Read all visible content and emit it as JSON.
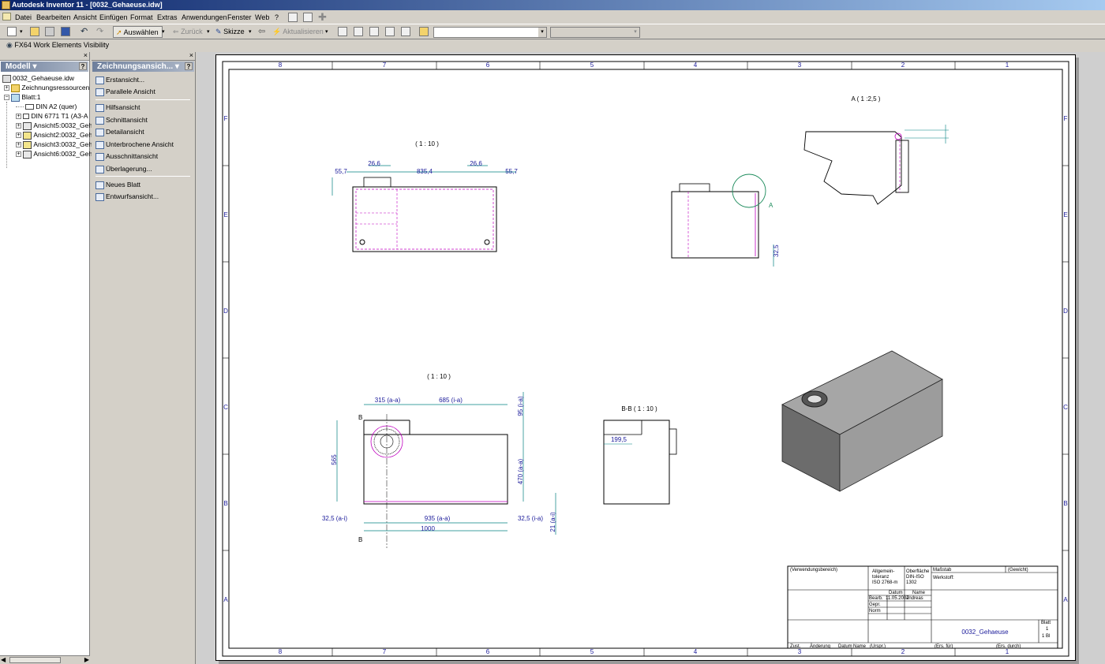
{
  "window": {
    "title": "Autodesk Inventor 11 - [0032_Gehaeuse.idw]"
  },
  "menu": [
    "Datei",
    "Bearbeiten",
    "Ansicht",
    "Einfügen",
    "Format",
    "Extras",
    "Anwendungen",
    "Fenster",
    "Web",
    "?"
  ],
  "toolbar": {
    "select_label": "Auswählen",
    "back_label": "Zurück",
    "sketch_label": "Skizze",
    "update_label": "Aktualisieren"
  },
  "toolbar2": {
    "visibility_label": "FX64 Work Elements Visibility"
  },
  "browser": {
    "title": "Modell",
    "root": "0032_Gehaeuse.idw",
    "items": [
      {
        "label": "Zeichnungsressourcen"
      },
      {
        "label": "Blatt:1"
      },
      {
        "label": "DIN A2 (quer)"
      },
      {
        "label": "DIN 6771 T1 (A3-A"
      },
      {
        "label": "Ansicht5:0032_Geh"
      },
      {
        "label": "Ansicht2:0032_Geh"
      },
      {
        "label": "Ansicht3:0032_Geh"
      },
      {
        "label": "Ansicht6:0032_Geh"
      }
    ]
  },
  "panel": {
    "title": "Zeichnungsansich...",
    "items": [
      {
        "label": "Erstansicht..."
      },
      {
        "label": "Parallele Ansicht"
      },
      {
        "label": "Hilfsansicht"
      },
      {
        "label": "Schnittansicht"
      },
      {
        "label": "Detailansicht"
      },
      {
        "label": "Unterbrochene Ansicht"
      },
      {
        "label": "Ausschnittansicht"
      },
      {
        "label": "Überlagerung..."
      },
      {
        "label": "Neues Blatt"
      },
      {
        "label": "Entwurfsansicht..."
      }
    ]
  },
  "drawing": {
    "zone_cols": [
      "8",
      "7",
      "6",
      "5",
      "4",
      "3",
      "2",
      "1"
    ],
    "zone_rows": [
      "F",
      "E",
      "D",
      "C",
      "B",
      "A"
    ],
    "view_top": {
      "scale": "( 1 : 10 )",
      "dims": [
        "55,7",
        "26,6",
        "835,4",
        "26,6",
        "55,7"
      ]
    },
    "view_side": {
      "detail_label": "A",
      "dim": "32,5"
    },
    "view_detail": {
      "label": "A ( 1 :2,5 )"
    },
    "view_front": {
      "scale": "( 1 : 10 )",
      "dims": [
        "315 (a-a)",
        "685 (i-a)",
        "95 (i-a)",
        "565",
        "470 (a-a)",
        "32,5 (a-i)",
        "935 (a-a)",
        "32,5 (i-a)",
        "21 (a-i)",
        "1000"
      ],
      "section_mark": "B"
    },
    "view_section": {
      "label": "B-B ( 1 : 10 )",
      "dim": "199,5"
    },
    "titleblock": {
      "usage": "(Verwendungsbereich)",
      "tolerance": "Allgemein-\ntoleranz\nISO 2768-m",
      "surface": "Oberfläche\nDIN-ISO\n1302",
      "scale": "Maßstab",
      "weight": "(Gewicht)",
      "material": "Werkstoff:",
      "date_h": "Datum",
      "name_h": "Name",
      "bearb": "Bearb.",
      "bearb_date": "11.05.2007",
      "bearb_name": "andreas",
      "gepr": "Gepr.",
      "norm": "Norm",
      "drawing_name": "0032_Gehaeuse",
      "sheet": "Blatt",
      "sheet_no": "1",
      "sheet_of": "1  Bl",
      "footer": [
        "Zust.",
        "Änderung",
        "Datum",
        "Name",
        "(Urspr.)",
        "(Ers. für)",
        "(Ers. durch)"
      ]
    }
  }
}
